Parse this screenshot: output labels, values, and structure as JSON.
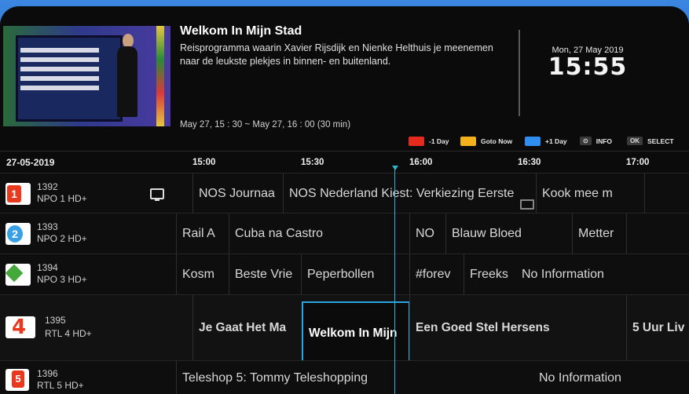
{
  "current": {
    "title": "Welkom In Mijn Stad",
    "description": "Reisprogramma waarin Xavier Rijsdijk en Nienke Helthuis je meenemen naar de leukste plekjes in binnen- en buitenland.",
    "time": "May 27,  15 : 30  ~ May 27,  16 : 00  (30 min)"
  },
  "clock": {
    "date": "Mon, 27 May 2019",
    "time": "15:55"
  },
  "legend": {
    "red": "-1 Day",
    "yellow": "Goto Now",
    "blue": "+1 Day",
    "info_key": "⊙",
    "info": "INFO",
    "ok_key": "OK",
    "select": "SELECT"
  },
  "colors": {
    "red": "#e52b1f",
    "yellow": "#f3b21b",
    "blue": "#2f8ef0",
    "accent": "#2aa3e0"
  },
  "timebar": {
    "date": "27-05-2019",
    "ticks": [
      "15:00",
      "15:30",
      "16:00",
      "16:30",
      "17:00"
    ]
  },
  "channels": [
    {
      "num": "1392",
      "name": "NPO 1 HD+",
      "logo": "1",
      "programs": [
        "NOS Journaa",
        "NOS Nederland Kiest: Verkiezing Eerste",
        "Kook mee m"
      ]
    },
    {
      "num": "1393",
      "name": "NPO 2 HD+",
      "logo": "2",
      "programs": [
        "Rail A",
        "Cuba na Castro",
        "NO",
        "Blauw Bloed",
        "Metter"
      ]
    },
    {
      "num": "1394",
      "name": "NPO 3 HD+",
      "logo": "3",
      "programs": [
        "Kosm",
        "Beste Vrie",
        "Peperbollen",
        "#forev",
        "Freeks",
        "No Information"
      ]
    },
    {
      "num": "1395",
      "name": "RTL 4 HD+",
      "logo": "RTL4",
      "programs": [
        "Je Gaat Het Ma",
        "Welkom In Mijn",
        "Een Goed Stel Hersens",
        "5 Uur Liv"
      ]
    },
    {
      "num": "1396",
      "name": "RTL 5 HD+",
      "logo": "rtl5",
      "programs": [
        "Teleshop 5: Tommy Teleshopping",
        "No Information"
      ]
    }
  ]
}
